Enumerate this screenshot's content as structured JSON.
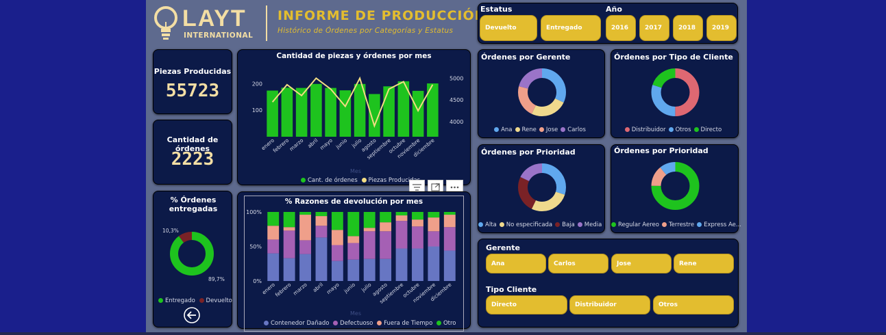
{
  "header": {
    "logo_main": "LAYT",
    "logo_sub": "INTERNATIONAL",
    "title": "INFORME DE PRODUCCIÓN",
    "subtitle": "Histórico de Órdenes por Categorías y Estatus"
  },
  "filters": {
    "estatus_label": "Estatus",
    "estatus": [
      "Devuelto",
      "Entregado"
    ],
    "anio_label": "Año",
    "anios": [
      "2016",
      "2017",
      "2018",
      "2019"
    ],
    "gerente_label": "Gerente",
    "gerentes": [
      "Ana",
      "Carlos",
      "Jose",
      "Rene"
    ],
    "tipo_label": "Tipo Cliente",
    "tipos": [
      "Directo",
      "Distribuidor",
      "Otros"
    ]
  },
  "kpis": {
    "piezas_label": "Piezas Producidas",
    "piezas_value": "55723",
    "ordenes_label": "Cantidad de órdenes",
    "ordenes_value": "2223"
  },
  "visual_header_icons": [
    "filter-icon",
    "focus-mode-icon",
    "more-options-icon"
  ],
  "colors": {
    "gold": "#e3bd2f",
    "bar_green": "#1ec31e",
    "line_yellow": "#f3dd83",
    "card_bg": "#0c1a48",
    "blue": "#60a8ee",
    "yellow": "#efd98d",
    "salmon": "#ef9f8a",
    "purple": "#9a74c8",
    "rose": "#de6872",
    "darkred": "#7a2226",
    "green": "#1ec31e"
  },
  "chart_data": [
    {
      "type": "bar",
      "title": "Cantidad de piezas y órdenes por mes",
      "xlabel": "Mes",
      "categories": [
        "enero",
        "febrero",
        "marzo",
        "abril",
        "mayo",
        "junio",
        "julio",
        "agosto",
        "septiembre",
        "octubre",
        "noviembre",
        "diciembre"
      ],
      "series": [
        {
          "name": "Cant. de órdenes",
          "type": "bar",
          "axis": "left",
          "values": [
            174,
            185,
            184,
            199,
            184,
            175,
            199,
            161,
            190,
            209,
            173,
            201
          ]
        },
        {
          "name": "Piezas Producidas",
          "type": "line",
          "axis": "right",
          "values": [
            4450,
            4850,
            4600,
            5000,
            4750,
            4350,
            5000,
            3900,
            4750,
            4920,
            4250,
            4850
          ]
        }
      ],
      "ylim_left": [
        0,
        250
      ],
      "yticks_left": [
        100,
        200
      ],
      "ylim_right": [
        3650,
        5180
      ],
      "yticks_right": [
        4000,
        4500,
        5000
      ]
    },
    {
      "type": "bar",
      "stacked": "percent",
      "title": "% Razones de devolución por mes",
      "xlabel": "Mes",
      "categories": [
        "enero",
        "febrero",
        "marzo",
        "abril",
        "mayo",
        "junio",
        "julio",
        "agosto",
        "septiembre",
        "octubre",
        "noviembre",
        "diciembre"
      ],
      "series": [
        {
          "name": "Contenedor Dañado",
          "values": [
            40,
            33,
            39,
            63,
            29,
            31,
            32,
            32,
            47,
            47,
            50,
            44
          ]
        },
        {
          "name": "Defectuoso",
          "values": [
            20,
            40,
            20,
            17,
            23,
            24,
            40,
            40,
            40,
            32,
            22,
            34
          ]
        },
        {
          "name": "Fuera de Tiempo",
          "values": [
            20,
            5,
            37,
            14,
            22,
            10,
            5,
            13,
            8,
            10,
            20,
            18
          ]
        },
        {
          "name": "Otro",
          "values": [
            20,
            22,
            4,
            6,
            26,
            35,
            23,
            15,
            5,
            11,
            8,
            4
          ]
        }
      ],
      "yticks": [
        "0%",
        "50%",
        "100%"
      ]
    },
    {
      "type": "pie",
      "donut": true,
      "title": "% Órdenes entregadas",
      "labels": [
        "Entregado",
        "Devuelto"
      ],
      "values": [
        89.7,
        10.3
      ],
      "data_labels": [
        "89,7%",
        "10,3%"
      ]
    },
    {
      "type": "pie",
      "donut": true,
      "title": "Órdenes por Gerente",
      "labels": [
        "Ana",
        "Rene",
        "Jose",
        "Carlos"
      ],
      "values": [
        32,
        25,
        22,
        21
      ]
    },
    {
      "type": "pie",
      "donut": true,
      "title": "Órdenes por Tipo de Cliente",
      "labels": [
        "Distribuidor",
        "Otros",
        "Directo"
      ],
      "values": [
        50,
        30,
        20
      ]
    },
    {
      "type": "pie",
      "donut": true,
      "title": "Órdenes por Prioridad",
      "labels": [
        "Alta",
        "No especificada",
        "Baja",
        "Media"
      ],
      "values": [
        30,
        27,
        25,
        18
      ]
    },
    {
      "type": "pie",
      "donut": true,
      "title": "Órdenes por Prioridad",
      "labels": [
        "Regular Aereo",
        "Terrestre",
        "Express Ae..."
      ],
      "values": [
        75,
        14,
        11
      ]
    }
  ]
}
